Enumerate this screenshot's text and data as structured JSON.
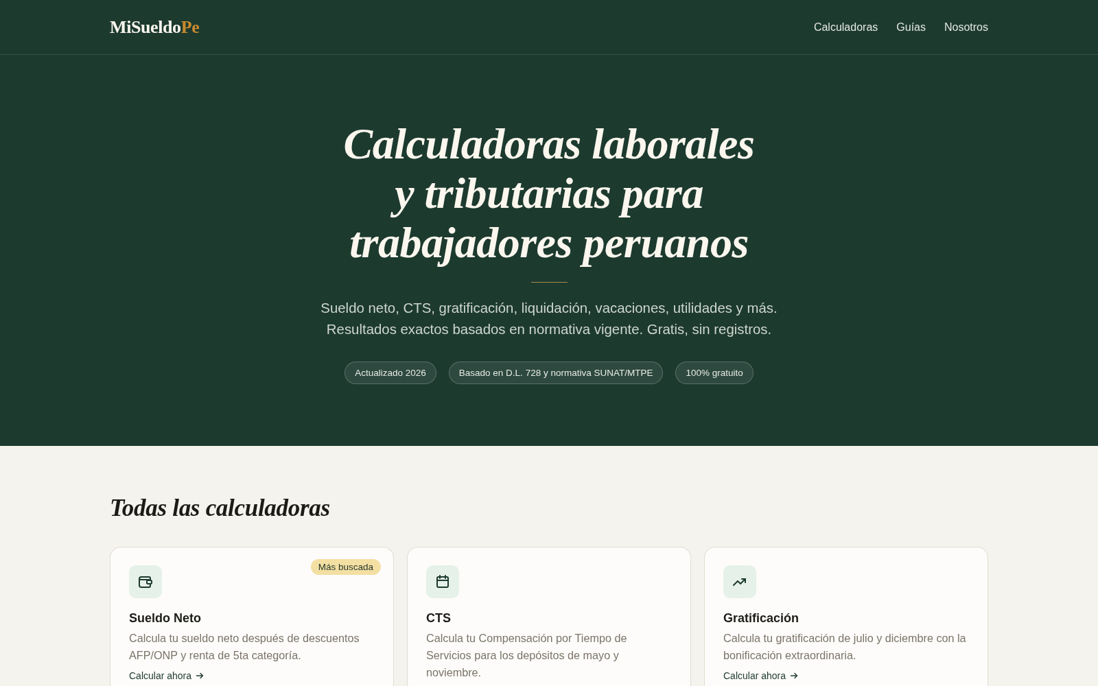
{
  "header": {
    "logo": {
      "text": "MiSueldo",
      "accent": "Pe"
    },
    "nav": [
      "Calculadoras",
      "Guías",
      "Nosotros"
    ]
  },
  "hero": {
    "title_lines": [
      "Calculadoras laborales",
      "y tributarias para",
      "trabajadores peruanos"
    ],
    "subtitle_lines": [
      "Sueldo neto, CTS, gratificación, liquidación, vacaciones, utilidades y más.",
      "Resultados exactos basados en normativa vigente. Gratis, sin registros."
    ],
    "tags": [
      "Actualizado 2026",
      "Basado en D.L. 728 y normativa SUNAT/MTPE",
      "100% gratuito"
    ]
  },
  "calculators": {
    "heading": "Todas las calculadoras",
    "cards": [
      {
        "title": "Sueldo Neto",
        "badge": "Más buscada",
        "description": "Calcula tu sueldo neto después de descuentos AFP/ONP y renta de 5ta categoría.",
        "link": "Calcular ahora"
      },
      {
        "title": "CTS",
        "description": "Calcula tu Compensación por Tiempo de Servicios para los depósitos de mayo y noviembre."
      },
      {
        "title": "Gratificación",
        "description": "Calcula tu gratificación de julio y diciembre con la bonificación extraordinaria.",
        "link": "Calcular ahora"
      }
    ]
  }
}
